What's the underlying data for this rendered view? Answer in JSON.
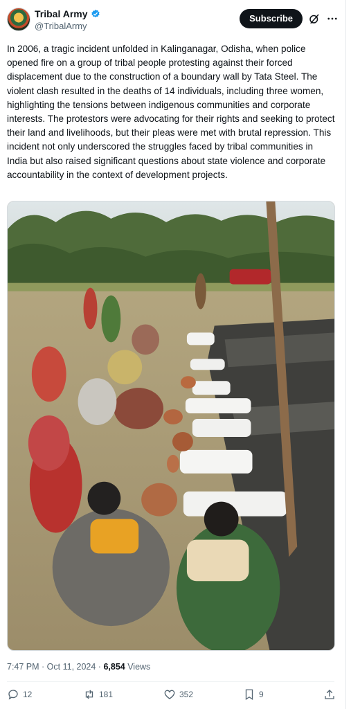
{
  "author": {
    "display_name": "Tribal Army",
    "handle": "@TribalArmy"
  },
  "header": {
    "subscribe_label": "Subscribe"
  },
  "post": {
    "text": "In 2006, a tragic incident unfolded in Kalinganagar, Odisha, when police opened fire on a group of tribal people protesting against their forced displacement due to the construction of a boundary wall by Tata Steel. The violent clash resulted in the deaths of 14 individuals, including three women, highlighting the tensions between indigenous communities and corporate interests. The protestors were advocating for their rights and seeking to protect their land and livelihoods, but their pleas were met with brutal repression. This incident not only underscored the struggles faced by tribal communities in India but also raised significant questions about state violence and corporate accountability in the context of development projects."
  },
  "meta": {
    "time": "7:47 PM",
    "separator": " · ",
    "date": "Oct 11, 2024",
    "views_count": "6,854",
    "views_label": " Views"
  },
  "actions": {
    "replies": "12",
    "reposts": "181",
    "likes": "352",
    "bookmarks": "9"
  },
  "colors": {
    "accent": "#1d9bf0",
    "text": "#0f1419",
    "muted": "#536471"
  }
}
